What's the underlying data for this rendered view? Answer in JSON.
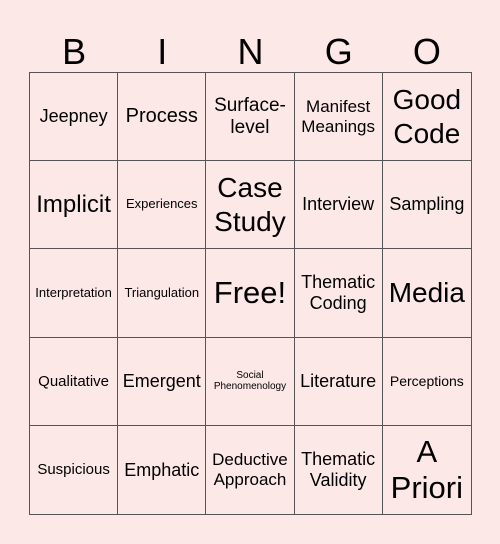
{
  "header": {
    "letters": [
      "B",
      "I",
      "N",
      "G",
      "O"
    ]
  },
  "board": {
    "cells": [
      {
        "text": "Jeepney",
        "size": "s18"
      },
      {
        "text": "Process",
        "size": "s20"
      },
      {
        "text": "Surface-level",
        "size": "s19"
      },
      {
        "text": "Manifest Meanings",
        "size": "s17"
      },
      {
        "text": "Good Code",
        "size": "s28"
      },
      {
        "text": "Implicit",
        "size": "s24"
      },
      {
        "text": "Experiences",
        "size": "s13"
      },
      {
        "text": "Case Study",
        "size": "s28"
      },
      {
        "text": "Interview",
        "size": "s18"
      },
      {
        "text": "Sampling",
        "size": "s18"
      },
      {
        "text": "Interpretation",
        "size": "s13"
      },
      {
        "text": "Triangulation",
        "size": "s13"
      },
      {
        "text": "Free!",
        "size": "s31"
      },
      {
        "text": "Thematic Coding",
        "size": "s18"
      },
      {
        "text": "Media",
        "size": "s28"
      },
      {
        "text": "Qualitative",
        "size": "s15"
      },
      {
        "text": "Emergent",
        "size": "s18"
      },
      {
        "text": "Social Phenomenology",
        "size": "s10"
      },
      {
        "text": "Literature",
        "size": "s18"
      },
      {
        "text": "Perceptions",
        "size": "s14"
      },
      {
        "text": "Suspicious",
        "size": "s15"
      },
      {
        "text": "Emphatic",
        "size": "s18"
      },
      {
        "text": "Deductive Approach",
        "size": "s17"
      },
      {
        "text": "Thematic Validity",
        "size": "s18"
      },
      {
        "text": "A Priori",
        "size": "s31"
      }
    ]
  }
}
